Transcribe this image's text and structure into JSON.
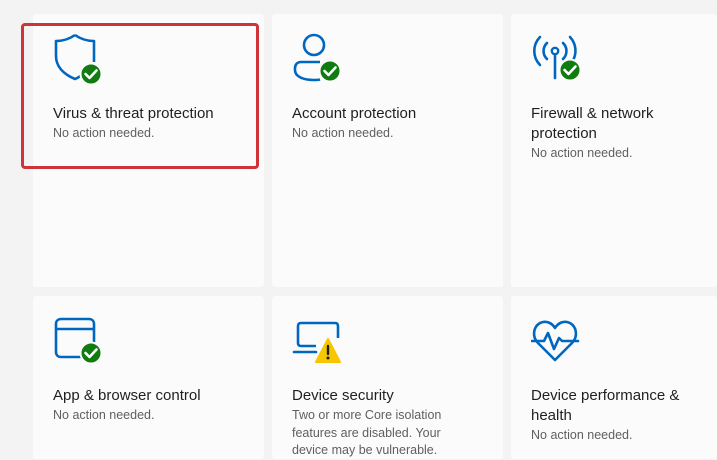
{
  "tiles": [
    {
      "title": "Virus & threat protection",
      "status": "No action needed.",
      "icon": "shield-check-icon"
    },
    {
      "title": "Account protection",
      "status": "No action needed.",
      "icon": "person-check-icon"
    },
    {
      "title": "Firewall & network protection",
      "status": "No action needed.",
      "icon": "antenna-check-icon"
    },
    {
      "title": "App & browser control",
      "status": "No action needed.",
      "icon": "browser-window-check-icon"
    },
    {
      "title": "Device security",
      "status": "Two or more Core isolation features are disabled.  Your device may be vulnerable.",
      "icon": "laptop-warning-icon"
    },
    {
      "title": "Device performance & health",
      "status": "No action needed.",
      "icon": "heart-pulse-icon"
    }
  ],
  "colors": {
    "accent": "#0067c0",
    "ok_badge": "#107c10",
    "warn_badge": "#f7c600",
    "highlight_border": "#d13438"
  }
}
